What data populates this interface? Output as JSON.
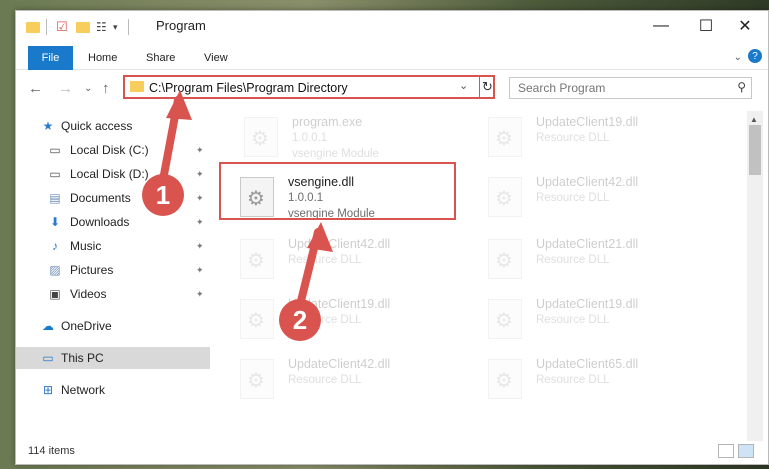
{
  "window": {
    "title": "Program",
    "min_glyph": "—",
    "max_glyph": "☐",
    "close_glyph": "✕"
  },
  "ribbon": {
    "tabs": [
      "File",
      "Home",
      "Share",
      "View"
    ],
    "expand_glyph": "⌄",
    "help_glyph": "?"
  },
  "address": {
    "path": "C:\\Program Files\\Program Directory",
    "dropdown_glyph": "⌄",
    "refresh_glyph": "↻"
  },
  "search": {
    "placeholder": "Search Program",
    "icon": "search-icon"
  },
  "nav": {
    "back_glyph": "←",
    "forward_glyph": "→",
    "recent_glyph": "⌄",
    "up_glyph": "↑"
  },
  "sidebar": {
    "items": [
      {
        "label": "Quick access",
        "icon": "star-icon",
        "glyph": "★",
        "pinned": false,
        "selected": false
      },
      {
        "label": "Local Disk (C:)",
        "icon": "drive-icon",
        "glyph": "▭",
        "pinned": true,
        "selected": false
      },
      {
        "label": "Local Disk (D:)",
        "icon": "drive-icon",
        "glyph": "▭",
        "pinned": true,
        "selected": false
      },
      {
        "label": "Documents",
        "icon": "documents-icon",
        "glyph": "▤",
        "pinned": true,
        "selected": false
      },
      {
        "label": "Downloads",
        "icon": "downloads-icon",
        "glyph": "⬇",
        "pinned": true,
        "selected": false
      },
      {
        "label": "Music",
        "icon": "music-icon",
        "glyph": "♪",
        "pinned": true,
        "selected": false
      },
      {
        "label": "Pictures",
        "icon": "pictures-icon",
        "glyph": "▨",
        "pinned": true,
        "selected": false
      },
      {
        "label": "Videos",
        "icon": "videos-icon",
        "glyph": "▣",
        "pinned": true,
        "selected": false
      },
      {
        "label": "OneDrive",
        "icon": "cloud-icon",
        "glyph": "☁",
        "pinned": false,
        "selected": false
      },
      {
        "label": "This PC",
        "icon": "computer-icon",
        "glyph": "▭",
        "pinned": false,
        "selected": true
      },
      {
        "label": "Network",
        "icon": "network-icon",
        "glyph": "⊞",
        "pinned": false,
        "selected": false
      }
    ],
    "pin_glyph": "📌"
  },
  "files": [
    {
      "name": "program.exe",
      "line2": "1.0.0.1",
      "line3": "vsengine Module",
      "faded": true
    },
    {
      "name": "UpdateClient19.dll",
      "line2": "Resource DLL",
      "line3": "",
      "faded": true
    },
    {
      "name": "vsengine.dll",
      "line2": "1.0.0.1",
      "line3": "vsengine Module",
      "faded": false
    },
    {
      "name": "UpdateClient42.dll",
      "line2": "Resource DLL",
      "line3": "",
      "faded": true
    },
    {
      "name": "UpdateClient42.dll",
      "line2": "Resource DLL",
      "line3": "",
      "faded": true
    },
    {
      "name": "UpdateClient21.dll",
      "line2": "Resource DLL",
      "line3": "",
      "faded": true
    },
    {
      "name": "UpdateClient19.dll",
      "line2": "Resource DLL",
      "line3": "",
      "faded": true
    },
    {
      "name": "UpdateClient19.dll",
      "line2": "Resource DLL",
      "line3": "",
      "faded": true
    },
    {
      "name": "UpdateClient42.dll",
      "line2": "Resource DLL",
      "line3": "",
      "faded": true
    },
    {
      "name": "UpdateClient65.dll",
      "line2": "Resource DLL",
      "line3": "",
      "faded": true
    }
  ],
  "status": {
    "item_count": "114 items"
  },
  "annotations": {
    "step1": "1",
    "step2": "2",
    "color": "#d9534f"
  },
  "colors": {
    "accent": "#1979ca",
    "highlight": "#d9534f",
    "folder": "#f7cd5c"
  }
}
